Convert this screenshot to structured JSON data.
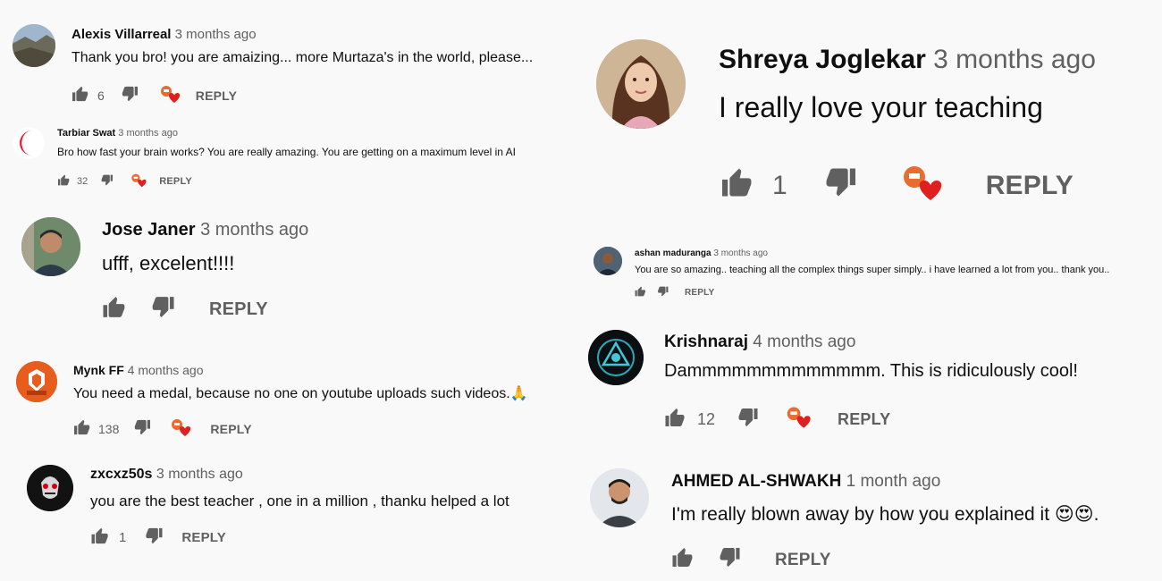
{
  "reply_label": "REPLY",
  "colors": {
    "heart": "#e0201f",
    "icon": "#606060",
    "name": "#0f0f0f",
    "meta": "#606060"
  },
  "comments": [
    {
      "author": "Alexis Villarreal",
      "time": "3 months ago",
      "text": "Thank you bro! you are amaizing... more Murtaza's in the world, please...",
      "likes": "6",
      "hearted": true,
      "avatar": "landscape-photo"
    },
    {
      "author": "Tarbiar Swat",
      "time": "3 months ago",
      "text": "Bro how fast your brain works? You are really amazing. You are getting on a maximum level in AI",
      "likes": "32",
      "hearted": true,
      "avatar": "red-crescent-logo"
    },
    {
      "author": "Jose Janer",
      "time": "3 months ago",
      "text": "ufff,  excelent!!!!",
      "likes": "",
      "hearted": false,
      "avatar": "man-photo"
    },
    {
      "author": "Mynk FF",
      "time": "4 months ago",
      "text": "You need a medal, because no one on youtube uploads such videos.🙏",
      "likes": "138",
      "hearted": true,
      "avatar": "orange-lion-logo"
    },
    {
      "author": "zxcxz50s",
      "time": "3 months ago",
      "text": "you are the best teacher , one in a million , thanku helped a lot",
      "likes": "1",
      "hearted": false,
      "avatar": "dark-mask-logo"
    },
    {
      "author": "Shreya Joglekar",
      "time": "3 months ago",
      "text": "I really love your teaching",
      "likes": "1",
      "hearted": true,
      "avatar": "woman-photo"
    },
    {
      "author": "ashan maduranga",
      "time": "3 months ago",
      "text": "You are so amazing.. teaching all the complex things super simply.. i have learned a lot from you.. thank you..",
      "likes": "",
      "hearted": false,
      "avatar": "man-photo"
    },
    {
      "author": "Krishnaraj",
      "time": "4 months ago",
      "text": "Dammmmmmmmmmmmm. This is ridiculously cool!",
      "likes": "12",
      "hearted": true,
      "avatar": "arc-reactor-logo"
    },
    {
      "author": "AHMED AL-SHWAKH",
      "time": "1 month ago",
      "text": "I'm really blown away by how you explained it 😍😍.",
      "likes": "",
      "hearted": false,
      "avatar": "man-photo"
    }
  ]
}
